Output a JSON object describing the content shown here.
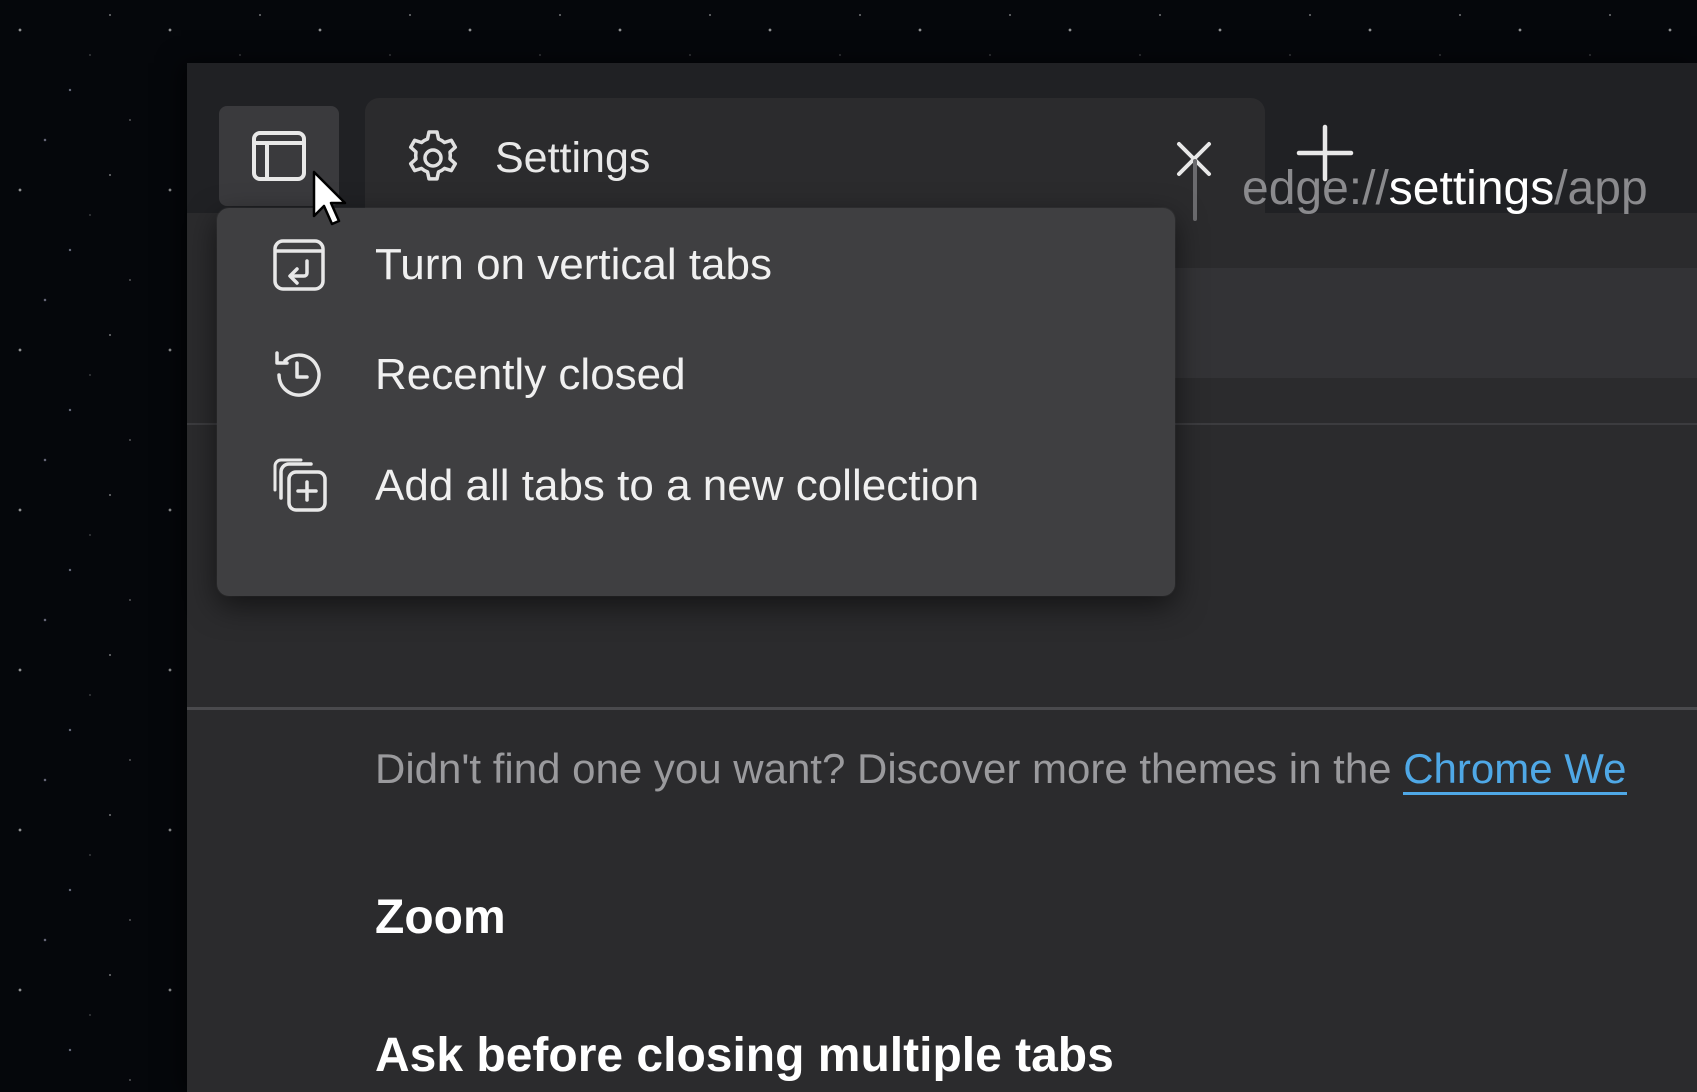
{
  "tab": {
    "title": "Settings",
    "icon": "gear-icon"
  },
  "toolbar": {
    "url_prefix": "edge://",
    "url_strong": "settings",
    "url_suffix": "/app"
  },
  "menu": {
    "items": [
      {
        "label": "Turn on vertical tabs",
        "icon": "vertical-tabs-icon"
      },
      {
        "label": "Recently closed",
        "icon": "history-icon"
      },
      {
        "label": "Add all tabs to a new collection",
        "icon": "add-collection-icon"
      }
    ]
  },
  "content": {
    "discover_text": "Didn't find one you want? Discover more themes in the ",
    "discover_link": "Chrome We",
    "zoom_heading": "Zoom",
    "ask_heading": "Ask before closing multiple tabs"
  },
  "colors": {
    "window_bg": "#202124",
    "menu_bg": "#3f3f41",
    "link": "#4fa8e6"
  }
}
